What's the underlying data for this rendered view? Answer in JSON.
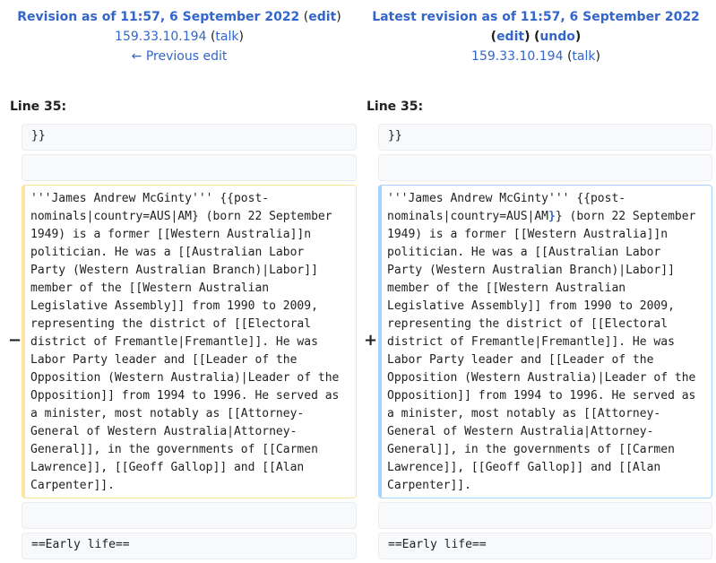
{
  "left_header": {
    "title": "Revision as of 11:57, 6 September 2022",
    "edit": "edit",
    "user": "159.33.10.194",
    "talk": "talk",
    "prev": "← Previous edit"
  },
  "right_header": {
    "title": "Latest revision as of 11:57, 6 September 2022",
    "edit": "edit",
    "undo": "undo",
    "user": "159.33.10.194",
    "talk": "talk"
  },
  "left_line": "Line 35:",
  "right_line": "Line 35:",
  "context_top": "}}",
  "context_bottom": "==Early life==",
  "markers": {
    "del": "−",
    "add": "+"
  },
  "removed_text": "'''James Andrew McGinty''' {{post-\nnominals|country=AUS|AM} (born 22 September\n1949) is a former [[Western Australia]]n\npolitician. He was a [[Australian Labor\nParty (Western Australian Branch)|Labor]]\nmember of the [[Western Australian\nLegislative Assembly]] from 1990 to 2009,\nrepresenting the district of [[Electoral\ndistrict of Fremantle|Fremantle]]. He was\nLabor Party leader and [[Leader of the\nOpposition (Western Australia)|Leader of the\nOpposition]] from 1994 to 1996. He served as\na minister, most notably as [[Attorney-\nGeneral of Western Australia|Attorney-\nGeneral]], in the governments of [[Carmen\nLawrence]], [[Geoff Gallop]] and [[Alan\nCarpenter]].",
  "added": {
    "before": "'''James Andrew McGinty''' {{post-\nnominals|country=AUS|AM",
    "inserted": "}",
    "after": "} (born 22 September\n1949) is a former [[Western Australia]]n\npolitician. He was a [[Australian Labor\nParty (Western Australian Branch)|Labor]]\nmember of the [[Western Australian\nLegislative Assembly]] from 1990 to 2009,\nrepresenting the district of [[Electoral\ndistrict of Fremantle|Fremantle]]. He was\nLabor Party leader and [[Leader of the\nOpposition (Western Australia)|Leader of the\nOpposition]] from 1994 to 1996. He served as\na minister, most notably as [[Attorney-\nGeneral of Western Australia|Attorney-\nGeneral]], in the governments of [[Carmen\nLawrence]], [[Geoff Gallop]] and [[Alan\nCarpenter]]."
  }
}
